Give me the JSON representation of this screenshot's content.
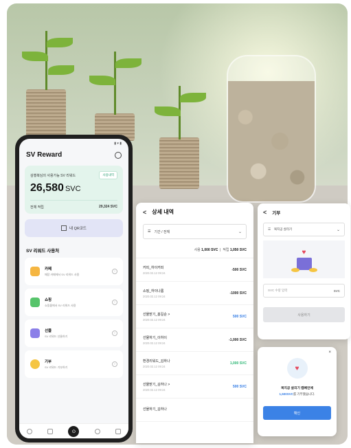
{
  "app": {
    "title": "SV Reward",
    "balance_label": "김행복님의 사용가능 SV 리워드",
    "history_chip": "사용내역",
    "balance_value": "26,580",
    "balance_unit": "SVC",
    "total_label": "전체 적립",
    "total_value": "29,324 SVC",
    "qr_button": "내 QR코드",
    "section_title": "SV 리워드 사용처",
    "uses": [
      {
        "name": "카페",
        "desc": "매장 카페에서 SV 리워드 사용",
        "color": "#f5b642"
      },
      {
        "name": "쇼핑",
        "desc": "쇼핑몰에서 SV 리워드 사용",
        "color": "#57c46b"
      },
      {
        "name": "선물",
        "desc": "SV 리워드 선물하기",
        "color": "#8b7fe8"
      },
      {
        "name": "기부",
        "desc": "SV 리워드 기부하기",
        "color": "#f5c542"
      }
    ],
    "tabbar_center": "⊙"
  },
  "detail": {
    "back": "<",
    "title": "상세 내역",
    "period_select": "기간 / 전체",
    "summary_used_label": "사용",
    "summary_used": "1,000 SVC",
    "summary_saved_label": "적립",
    "summary_saved": "1,050 SVC",
    "rows": [
      {
        "name": "커피_하이커피",
        "date": "2020.02.12 09:24",
        "amount": "-500 SVC",
        "color": "#222222"
      },
      {
        "name": "쇼핑_하이나롬",
        "date": "2020.02.12 09:24",
        "amount": "-1000 SVC",
        "color": "#222222"
      },
      {
        "name": "선물받기_홍길순 >",
        "date": "2020.02.12 09:24",
        "amount": "500 SVC",
        "color": "#2f7ae5"
      },
      {
        "name": "선물하기_이하이",
        "date": "2020.02.12 09:24",
        "amount": "-1,000 SVC",
        "color": "#222222"
      },
      {
        "name": "환경리워드_김하나",
        "date": "2020.02.12 09:24",
        "amount": "1,000 SVC",
        "color": "#2bb673"
      },
      {
        "name": "선물받기_김하나 >",
        "date": "2020.02.12 09:24",
        "amount": "500 SVC",
        "color": "#2f7ae5"
      },
      {
        "name": "선물하기_김하나",
        "date": "",
        "amount": "",
        "color": "#222222"
      }
    ]
  },
  "donation": {
    "back": "<",
    "title": "기부",
    "org_select": "복지공 살리기",
    "input_placeholder": "SVC 수량 입력",
    "input_unit": "SVC",
    "submit": "사용하기"
  },
  "complete": {
    "close": "×",
    "title": "복지공 살리기 캠페인에",
    "amount": "1,500SVC",
    "message_rest": "를 기부했습니다.",
    "confirm": "확인"
  }
}
